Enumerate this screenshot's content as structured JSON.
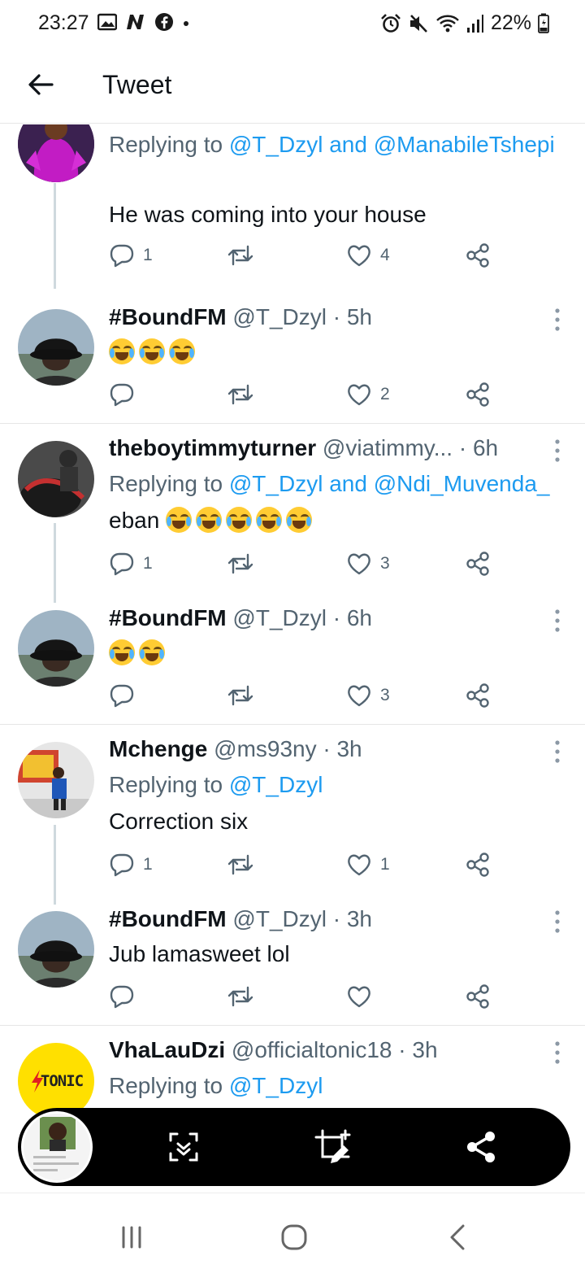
{
  "status_bar": {
    "time": "23:27",
    "battery": "22%"
  },
  "header": {
    "title": "Tweet"
  },
  "tweets": [
    {
      "replying_prefix": "Replying to ",
      "replying_mentions": "@T_Dzyl and @ManabileTshepi",
      "text": "He was coming into your house",
      "replies": "1",
      "likes": "4"
    },
    {
      "name": "#BoundFM",
      "handle_time": " @T_Dzyl · 5h",
      "emoji_count": 3,
      "likes": "2"
    },
    {
      "name": "theboytimmyturner",
      "handle_time": " @viatimmy... · 6h",
      "replying_prefix": "Replying to ",
      "replying_mentions": "@T_Dzyl and @Ndi_Muvenda_",
      "text": "eban",
      "emoji_count": 5,
      "replies": "1",
      "likes": "3"
    },
    {
      "name": "#BoundFM",
      "handle_time": " @T_Dzyl · 6h",
      "emoji_count": 2,
      "likes": "3"
    },
    {
      "name": "Mchenge",
      "handle_time": " @ms93ny · 3h",
      "replying_prefix": "Replying to ",
      "replying_mentions": "@T_Dzyl",
      "text": "Correction six",
      "replies": "1",
      "likes": "1"
    },
    {
      "name": "#BoundFM",
      "handle_time": " @T_Dzyl · 3h",
      "text": "Jub lamasweet lol"
    },
    {
      "name": "VhaLauDzi",
      "handle_time": " @officialtonic18 · 3h",
      "replying_prefix": "Replying to ",
      "replying_mentions": "@T_Dzyl",
      "avatar_text": "TONIC"
    }
  ],
  "colors": {
    "accent": "#1d9bf0",
    "secondary_text": "#536471",
    "divider": "#e6e6e6",
    "tonic_avatar": "#ffe000"
  },
  "icons": {
    "back": "arrow-left-icon",
    "reply": "reply-bubble-icon",
    "retweet": "retweet-icon",
    "like": "heart-icon",
    "share": "share-icon",
    "more": "more-vertical-icon",
    "scroll_capture": "scroll-capture-icon",
    "edit": "crop-edit-icon",
    "nav_recents": "recents-icon",
    "nav_home": "home-icon",
    "nav_back": "nav-back-icon"
  }
}
